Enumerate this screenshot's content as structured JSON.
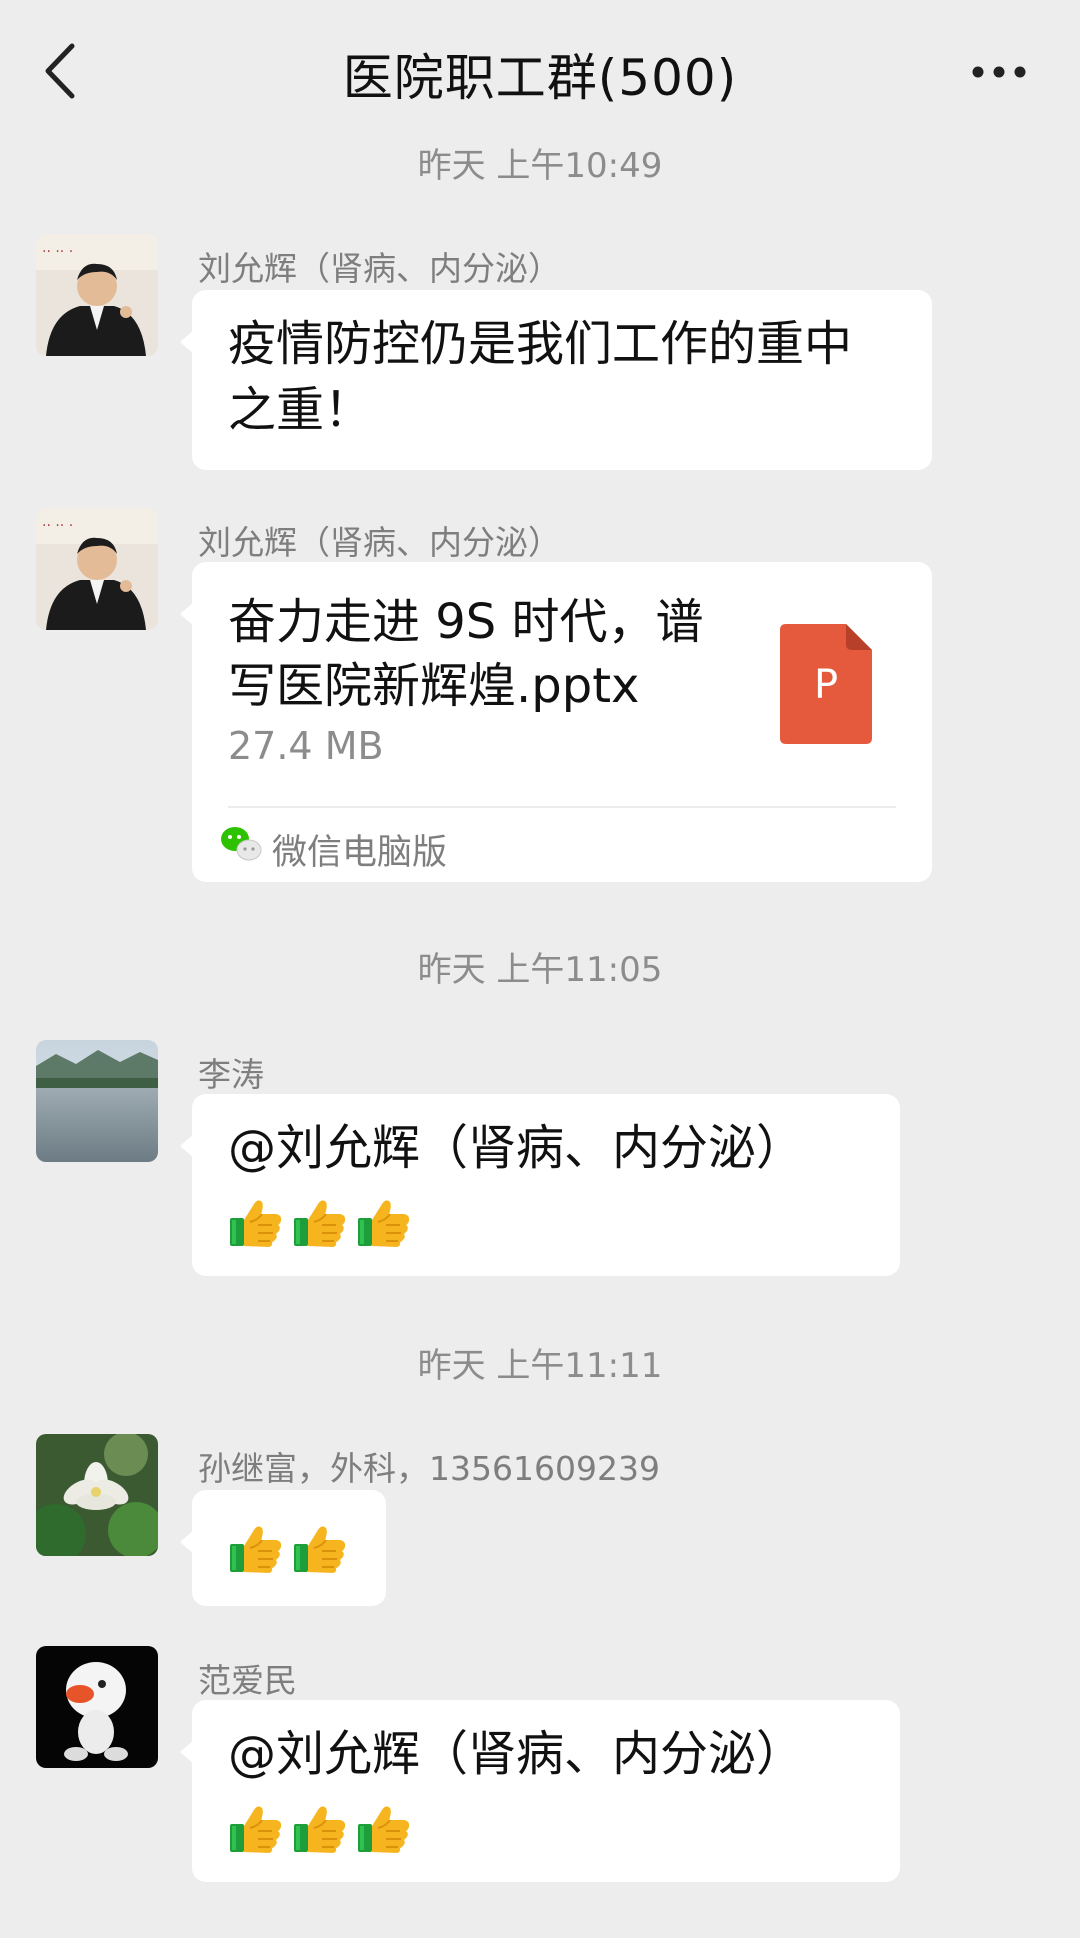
{
  "header": {
    "title": "医院职工群(500)"
  },
  "colors": {
    "background": "#ededed",
    "bubble": "#ffffff",
    "ppt_icon": "#e55a3c",
    "wechat_green": "#2dc100"
  },
  "timestamps": [
    "昨天 上午10:49",
    "昨天 上午11:05",
    "昨天 上午11:11"
  ],
  "messages": [
    {
      "sender": "刘允辉（肾病、内分泌）",
      "text_line1": "疫情防控仍是我们工作的重中",
      "text_line2": "之重！"
    },
    {
      "sender": "刘允辉（肾病、内分泌）",
      "file_line1": "奋力走进 9S 时代，谱",
      "file_line2": "写医院新辉煌.pptx",
      "file_size": "27.4 MB",
      "file_icon_letter": "P",
      "source": "微信电脑版"
    },
    {
      "sender": "李涛",
      "text": "@刘允辉（肾病、内分泌）",
      "thumbs": 3
    },
    {
      "sender": "孙继富，外科，13561609239",
      "thumbs": 2
    },
    {
      "sender": "范爱民",
      "text": "@刘允辉（肾病、内分泌）",
      "thumbs": 3
    }
  ],
  "icons": {
    "back": "chevron-left-icon",
    "more": "more-dots-icon",
    "file": "ppt-file-icon",
    "source": "wechat-icon",
    "reaction": "thumbs-up-emoji"
  }
}
